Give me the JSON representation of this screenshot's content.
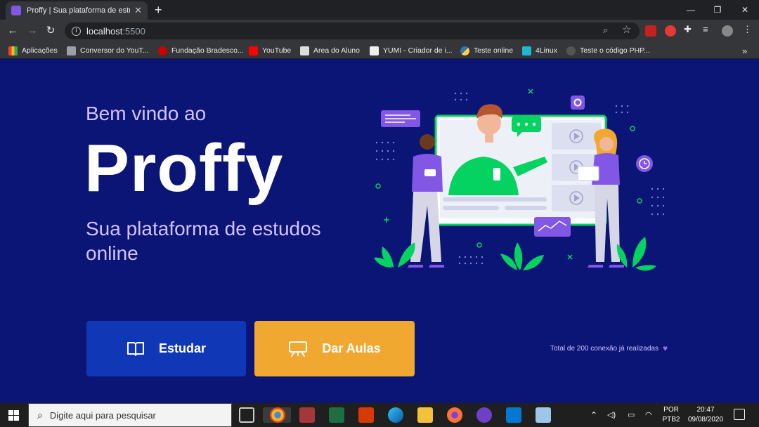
{
  "browser": {
    "tab_title": "Proffy | Sua plataforma de estudos online",
    "new_tab": "+",
    "close_tab": "✕",
    "url_host": "localhost",
    "url_port": ":5500",
    "minimize": "—",
    "restore": "❐",
    "close": "✕"
  },
  "bookmarks": [
    {
      "label": "Aplicações",
      "color": "#ea4335"
    },
    {
      "label": "Conversor do YouT...",
      "color": "#9aa0a6"
    },
    {
      "label": "Fundação Bradesco...",
      "color": "#cc0000"
    },
    {
      "label": "YouTube",
      "color": "#ff0000"
    },
    {
      "label": "Area do Aluno",
      "color": "#dddddd"
    },
    {
      "label": "YUMI - Criador de i...",
      "color": "#eeeeee"
    },
    {
      "label": "Teste online",
      "color": "#3776ab"
    },
    {
      "label": "4Linux",
      "color": "#1fb8cd"
    },
    {
      "label": "Teste o código PHP...",
      "color": "#555555"
    }
  ],
  "bookmarks_more": "»",
  "page": {
    "welcome": "Bem vindo ao",
    "logo": "Proffy",
    "subtitle": "Sua plataforma de estudos online",
    "study_button": "Estudar",
    "teach_button": "Dar Aulas",
    "connections": "Total de 200 conexão já realizadas",
    "heart": "♥"
  },
  "taskbar": {
    "search_placeholder": "Digite aqui para pesquisar",
    "lang_top": "POR",
    "lang_bottom": "PTB2",
    "time": "20:47",
    "date": "09/08/2020"
  },
  "colors": {
    "page_bg": "#0b1575",
    "study": "#1037b5",
    "teach": "#f1a831",
    "accent_purple": "#8257e5",
    "accent_green": "#04d361"
  }
}
